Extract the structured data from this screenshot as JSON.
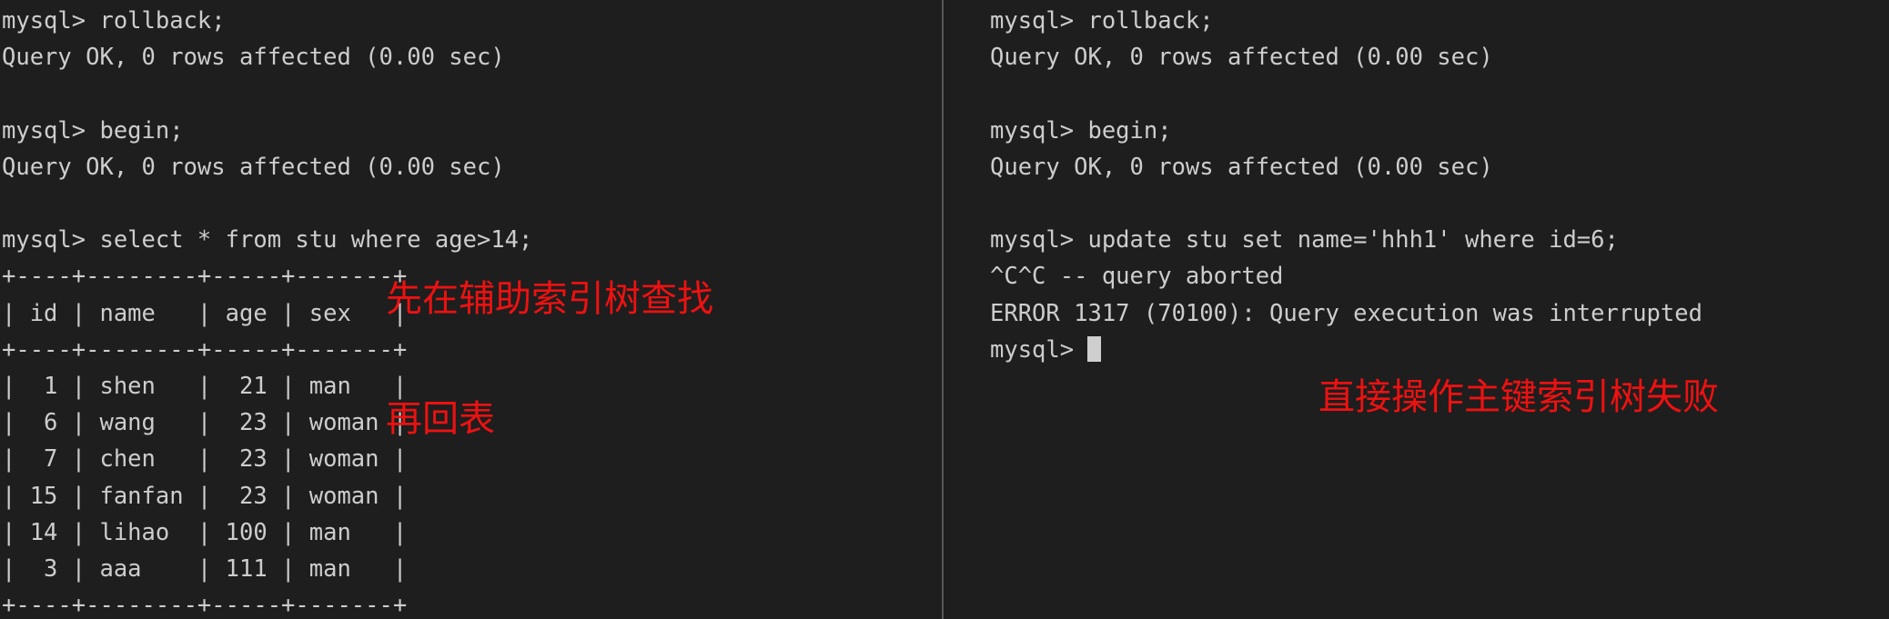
{
  "terminal": {
    "background_color": "#1e1e1e",
    "text_color": "#cdcdcd",
    "divider_color": "#565656",
    "annotation_color": "#ee1111",
    "left_pane": {
      "name": "secondary-index-session",
      "lines": "mysql> rollback;\nQuery OK, 0 rows affected (0.00 sec)\n\nmysql> begin;\nQuery OK, 0 rows affected (0.00 sec)\n\nmysql> select * from stu where age>14;\n+----+--------+-----+-------+\n| id | name   | age | sex   |\n+----+--------+-----+-------+\n|  1 | shen   |  21 | man   |\n|  6 | wang   |  23 | woman |\n|  7 | chen   |  23 | woman |\n| 15 | fanfan |  23 | woman |\n| 14 | lihao  | 100 | man   |\n|  3 | aaa    | 111 | man   |\n+----+--------+-----+-------+",
      "commands": [
        "rollback;",
        "begin;",
        "select * from stu where age>14;"
      ],
      "responses": [
        "Query OK, 0 rows affected (0.00 sec)",
        "Query OK, 0 rows affected (0.00 sec)"
      ],
      "result_table": {
        "columns": [
          "id",
          "name",
          "age",
          "sex"
        ],
        "rows": [
          [
            "1",
            "shen",
            "21",
            "man"
          ],
          [
            "6",
            "wang",
            "23",
            "woman"
          ],
          [
            "7",
            "chen",
            "23",
            "woman"
          ],
          [
            "15",
            "fanfan",
            "23",
            "woman"
          ],
          [
            "14",
            "lihao",
            "100",
            "man"
          ],
          [
            "3",
            "aaa",
            "111",
            "man"
          ]
        ]
      },
      "annotation": "先在辅助索引树查找\n\n再回表"
    },
    "right_pane": {
      "name": "primary-index-session",
      "lines_before_prompt": "mysql> rollback;\nQuery OK, 0 rows affected (0.00 sec)\n\nmysql> begin;\nQuery OK, 0 rows affected (0.00 sec)\n\nmysql> update stu set name='hhh1' where id=6;\n^C^C -- query aborted\nERROR 1317 (70100): Query execution was interrupted\n",
      "commands": [
        "rollback;",
        "begin;",
        "update stu set name='hhh1' where id=6;"
      ],
      "responses": [
        "Query OK, 0 rows affected (0.00 sec)",
        "Query OK, 0 rows affected (0.00 sec)",
        "^C^C -- query aborted",
        "ERROR 1317 (70100): Query execution was interrupted"
      ],
      "error_code": "ERROR 1317 (70100)",
      "error_message": "Query execution was interrupted",
      "prompt": "mysql> ",
      "annotation": "直接操作主键索引树失败"
    }
  }
}
